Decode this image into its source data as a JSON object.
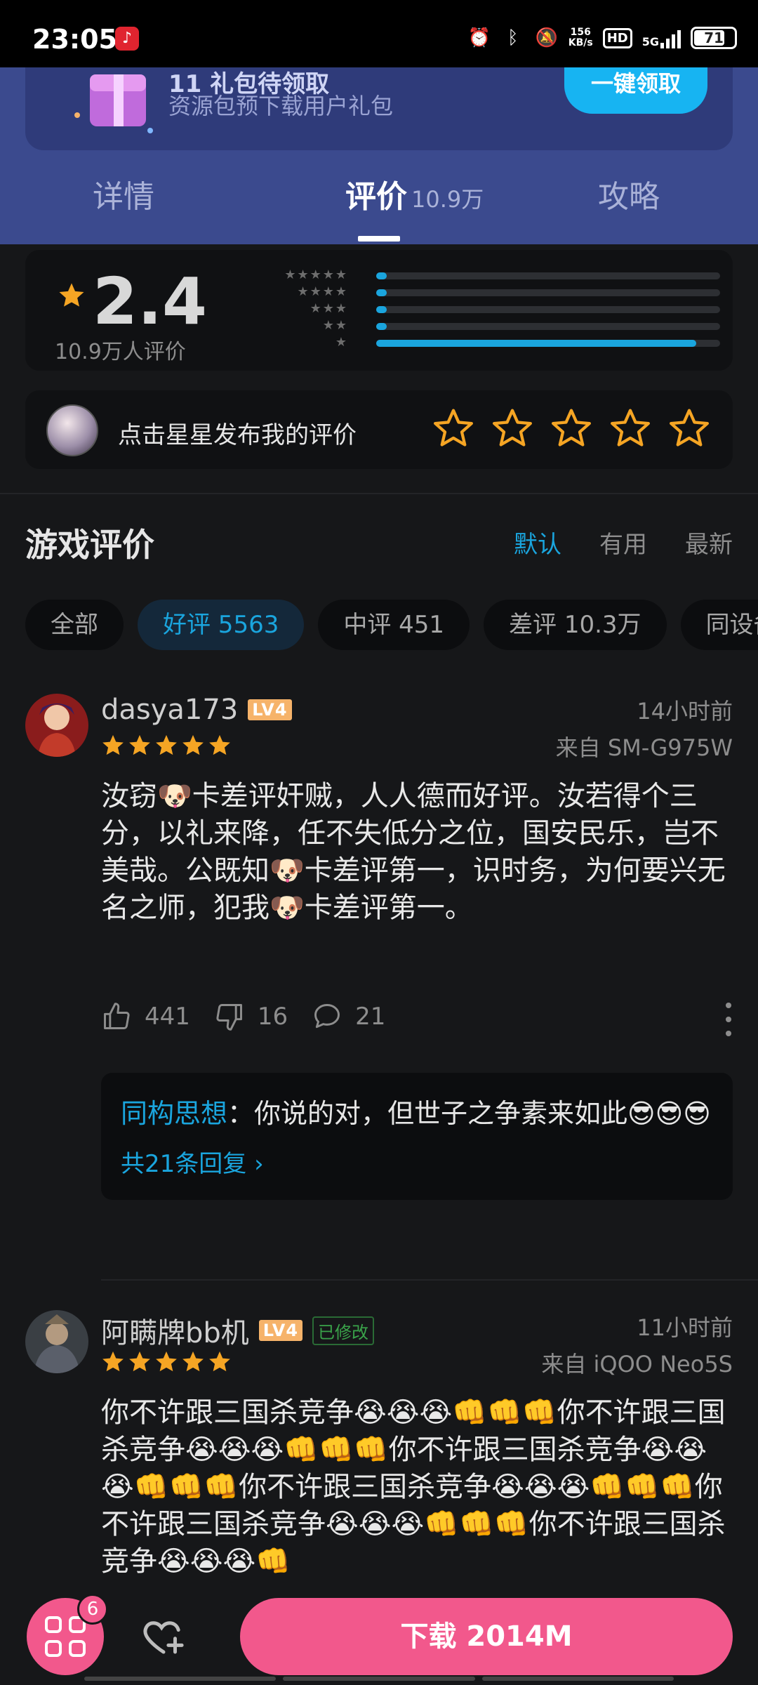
{
  "status_bar": {
    "time": "23:05",
    "speed_value": "156",
    "speed_unit": "KB/s",
    "hd": "HD",
    "network": "5G",
    "battery": "71"
  },
  "promo": {
    "title": "11 礼包待领取",
    "subtitle": "资源包预下载用户礼包",
    "button": "一键领取"
  },
  "tabs": [
    {
      "label": "详情"
    },
    {
      "label": "评价",
      "count": "10.9万"
    },
    {
      "label": "攻略"
    }
  ],
  "rating": {
    "score": "2.4",
    "count_label": "10.9万人评价",
    "distribution": [
      {
        "stars": "★★★★★",
        "fraction": 0.03
      },
      {
        "stars": "★★★★",
        "fraction": 0.003
      },
      {
        "stars": "★★★",
        "fraction": 0.003
      },
      {
        "stars": "★★",
        "fraction": 0.003
      },
      {
        "stars": "★",
        "fraction": 0.93
      }
    ],
    "accent_color": "#1aa5de"
  },
  "rate_prompt": {
    "label": "点击星星发布我的评价"
  },
  "reviews_section": {
    "title": "游戏评价",
    "sort_options": [
      "默认",
      "有用",
      "最新"
    ],
    "filters": [
      "全部",
      "好评 5563",
      "中评 451",
      "差评 10.3万",
      "同设备"
    ]
  },
  "reviews": [
    {
      "user": "dasya173",
      "level": "LV4",
      "time": "14小时前",
      "device": "来自 SM-G975W",
      "text": "汝窃🐶卡差评奸贼，人人德而好评。汝若得个三分，以礼来降，任不失低分之位，国安民乐，岂不美哉。公既知🐶卡差评第一，识时务，为何要兴无名之师，犯我🐶卡差评第一。",
      "likes": "441",
      "dislikes": "16",
      "comments": "21",
      "reply": {
        "author": "同构思想",
        "text": "：你说的对，但世子之争素来如此😎😎😎",
        "more": "共21条回复"
      }
    },
    {
      "user": "阿瞒牌bb机",
      "level": "LV4",
      "edited": "已修改",
      "time": "11小时前",
      "device": "来自 iQOO Neo5S",
      "text": "你不许跟三国杀竞争😭😭😭👊👊👊你不许跟三国杀竞争😭😭😭👊👊👊你不许跟三国杀竞争😭😭😭👊👊👊你不许跟三国杀竞争😭😭😭👊👊👊你不许跟三国杀竞争😭😭😭👊👊👊你不许跟三国杀竞争😭😭😭👊"
    }
  ],
  "bottom_bar": {
    "badge": "6",
    "download": "下载 2014M"
  }
}
